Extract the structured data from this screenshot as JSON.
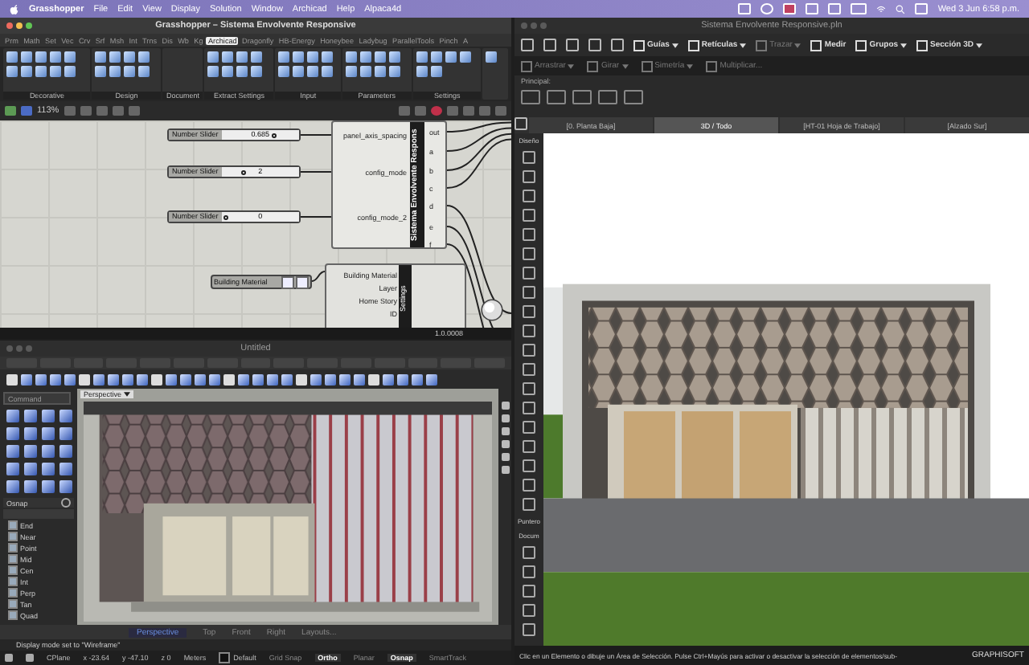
{
  "menubar": {
    "app": "Grasshopper",
    "menus": [
      "File",
      "Edit",
      "View",
      "Display",
      "Solution",
      "Window",
      "Archicad",
      "Help",
      "Alpaca4d"
    ],
    "clock": "Wed 3 Jun 6:58 p.m."
  },
  "grasshopper": {
    "title": "Grasshopper – Sistema Envolvente Responsive",
    "tabs": [
      {
        "label": "Prm",
        "selected": false
      },
      {
        "label": "Math",
        "selected": false
      },
      {
        "label": "Set",
        "selected": false
      },
      {
        "label": "Vec",
        "selected": false
      },
      {
        "label": "Crv",
        "selected": false
      },
      {
        "label": "Srf",
        "selected": false
      },
      {
        "label": "Msh",
        "selected": false
      },
      {
        "label": "Int",
        "selected": false
      },
      {
        "label": "Trns",
        "selected": false
      },
      {
        "label": "Dis",
        "selected": false
      },
      {
        "label": "Wb",
        "selected": false
      },
      {
        "label": "Kg",
        "selected": false
      },
      {
        "label": "Archicad",
        "selected": true
      },
      {
        "label": "Dragonfly",
        "selected": false
      },
      {
        "label": "HB-Energy",
        "selected": false
      },
      {
        "label": "Honeybee",
        "selected": false
      },
      {
        "label": "Ladybug",
        "selected": false
      },
      {
        "label": "ParallelTools",
        "selected": false
      },
      {
        "label": "Pinch",
        "selected": false
      },
      {
        "label": "A",
        "selected": false
      }
    ],
    "groups": [
      "Decorative",
      "Design",
      "Document",
      "Extract Settings",
      "Input",
      "Parameters",
      "Settings"
    ],
    "zoom": "113%",
    "sliders": [
      {
        "label": "Number Slider",
        "value": "0.685",
        "level": 0.65
      },
      {
        "label": "Number Slider",
        "value": "2",
        "level": 0.25
      },
      {
        "label": "Number Slider",
        "value": "0",
        "level": 0.02
      }
    ],
    "component": {
      "name": "Sistema Envolvente Respons",
      "inputs": [
        "panel_axis_spacing",
        "config_mode",
        "config_mode_2"
      ],
      "outputs": [
        "out",
        "a",
        "b",
        "c",
        "d",
        "e",
        "f"
      ]
    },
    "material_param": {
      "label": "Building Material"
    },
    "settings_component": {
      "name": "Settings",
      "inputs": [
        "Building Material",
        "Layer",
        "Home Story",
        "ID"
      ]
    },
    "version": "1.0.0008"
  },
  "rhino": {
    "title": "Untitled",
    "command_placeholder": "Command",
    "osnap_title": "Osnap",
    "osnaps": [
      {
        "label": "End",
        "checked": true
      },
      {
        "label": "Near",
        "checked": true
      },
      {
        "label": "Point",
        "checked": true
      },
      {
        "label": "Mid",
        "checked": true
      },
      {
        "label": "Cen",
        "checked": true
      },
      {
        "label": "Int",
        "checked": true
      },
      {
        "label": "Perp",
        "checked": true
      },
      {
        "label": "Tan",
        "checked": true
      },
      {
        "label": "Quad",
        "checked": true
      }
    ],
    "viewport": "Perspective",
    "view_tabs": [
      {
        "label": "Perspective",
        "selected": true
      },
      {
        "label": "Top",
        "selected": false
      },
      {
        "label": "Front",
        "selected": false
      },
      {
        "label": "Right",
        "selected": false
      },
      {
        "label": "Layouts...",
        "selected": false
      }
    ],
    "command_history": "Display mode set to \"Wireframe\"",
    "status": {
      "cplane": "CPlane",
      "x": "x -23.64",
      "y": "y -47.10",
      "z": "z 0",
      "units": "Meters",
      "layer": "Default"
    },
    "toggles": [
      {
        "label": "Grid Snap",
        "on": false
      },
      {
        "label": "Ortho",
        "on": true
      },
      {
        "label": "Planar",
        "on": false
      },
      {
        "label": "Osnap",
        "on": true
      },
      {
        "label": "SmartTrack",
        "on": false
      }
    ]
  },
  "archicad": {
    "title": "Sistema Envolvente Responsive.pln",
    "tools": [
      {
        "label": "Guías",
        "disabled": false,
        "dropdown": true
      },
      {
        "label": "Retículas",
        "disabled": false,
        "dropdown": true
      },
      {
        "label": "Trazar",
        "disabled": true,
        "dropdown": true
      },
      {
        "label": "Medir",
        "disabled": false,
        "dropdown": false
      },
      {
        "label": "Grupos",
        "disabled": false,
        "dropdown": true
      },
      {
        "label": "Sección 3D",
        "disabled": false,
        "dropdown": true
      }
    ],
    "edit_tools": [
      {
        "label": "Arrastrar",
        "disabled": true,
        "dropdown": true
      },
      {
        "label": "Girar",
        "disabled": true,
        "dropdown": true
      },
      {
        "label": "Simetría",
        "disabled": true,
        "dropdown": true
      },
      {
        "label": "Multiplicar...",
        "disabled": true,
        "dropdown": false
      }
    ],
    "principal": "Principal:",
    "tabs": [
      {
        "label": "[0. Planta Baja]",
        "selected": false
      },
      {
        "label": "3D / Todo",
        "selected": true
      },
      {
        "label": "[HT-01 Hoja de Trabajo]",
        "selected": false
      },
      {
        "label": "[Alzado Sur]",
        "selected": false
      }
    ],
    "toolbox": [
      "Diseño",
      "Puntero",
      "Docum"
    ],
    "status": "Clic en un Elemento o dibuje un Área de Selección. Pulse Ctrl+Mayús para activar o desactivar la selección de elementos/sub-",
    "brand": "GRAPHISOFT"
  }
}
